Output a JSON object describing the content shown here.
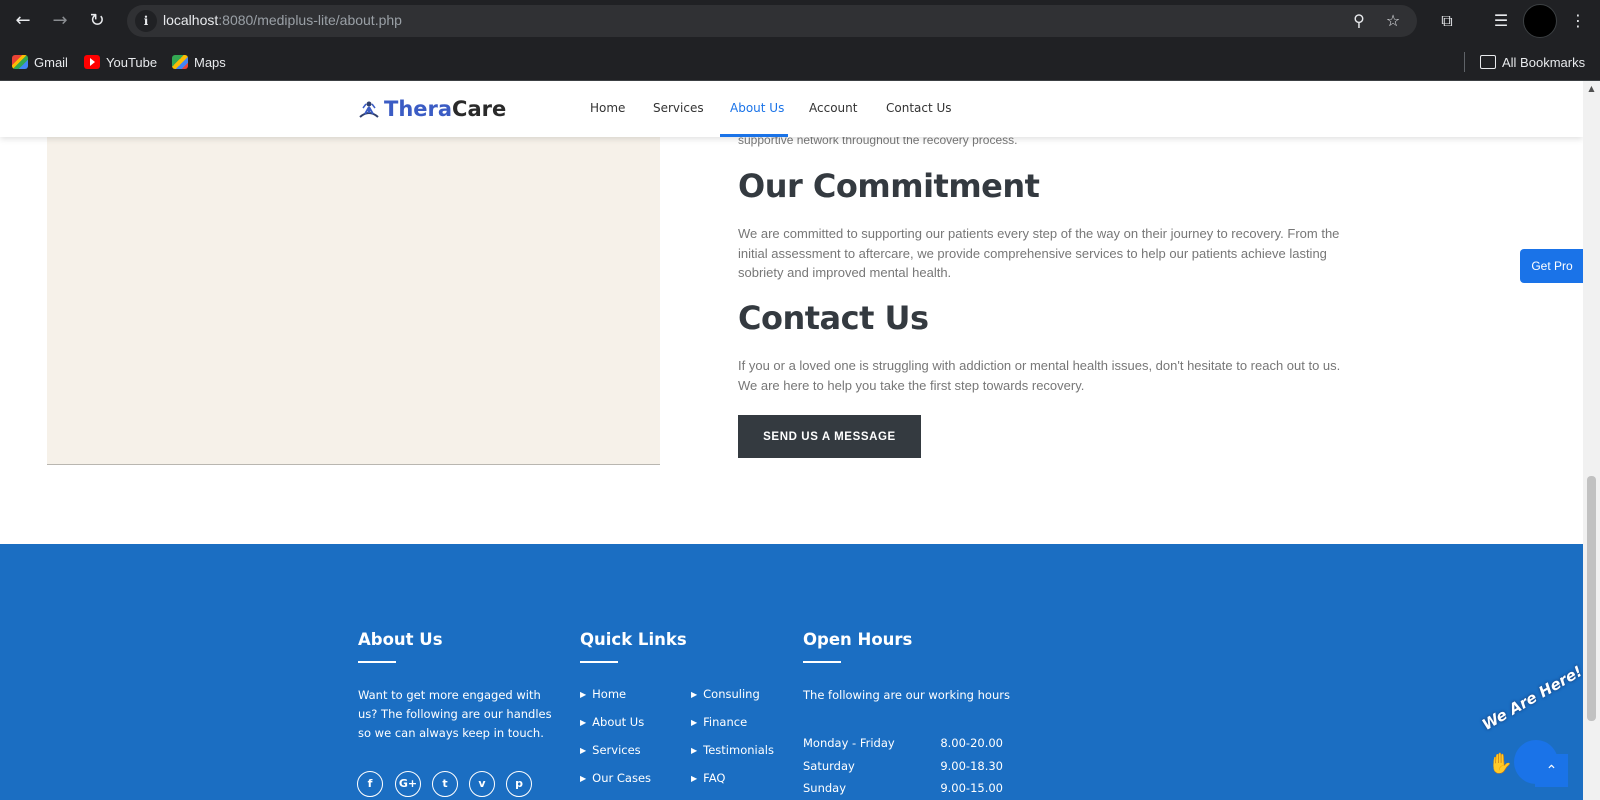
{
  "browser": {
    "url_host": "localhost",
    "url_rest": ":8080/mediplus-lite/about.php",
    "bookmarks": [
      {
        "label": "Gmail",
        "icon": "gmail-icon"
      },
      {
        "label": "YouTube",
        "icon": "youtube-icon"
      },
      {
        "label": "Maps",
        "icon": "maps-icon"
      }
    ],
    "all_bookmarks": "All Bookmarks"
  },
  "header": {
    "logo_part1": "Thera",
    "logo_part2": "Care",
    "menu": [
      "Home",
      "Services",
      "About Us",
      "Account",
      "Contact Us"
    ],
    "active_menu": "About Us"
  },
  "main": {
    "prev_text": "supportive network throughout the recovery process.",
    "commitment_title": "Our Commitment",
    "commitment_text": "We are committed to supporting our patients every step of the way on their journey to recovery. From the initial assessment to aftercare, we provide comprehensive services to help our patients achieve lasting sobriety and improved mental health.",
    "contact_title": "Contact Us",
    "contact_text": "If you or a loved one is struggling with addiction or mental health issues, don't hesitate to reach out to us. We are here to help you take the first step towards recovery.",
    "send_button": "SEND US A MESSAGE"
  },
  "footer": {
    "about_title": "About Us",
    "about_text": "Want to get more engaged with us? The following are our handles so we can always keep in touch.",
    "social": [
      "f",
      "G+",
      "t",
      "v",
      "p"
    ],
    "quick_links_title": "Quick Links",
    "quick_links_col1": [
      "Home",
      "About Us",
      "Services",
      "Our Cases"
    ],
    "quick_links_col2": [
      "Consuling",
      "Finance",
      "Testimonials",
      "FAQ"
    ],
    "open_hours_title": "Open Hours",
    "open_hours_text": "The following are our working hours",
    "hours": [
      {
        "day": "Monday - Friday",
        "time": "8.00-20.00"
      },
      {
        "day": "Saturday",
        "time": "9.00-18.30"
      },
      {
        "day": "Sunday",
        "time": "9.00-15.00"
      }
    ]
  },
  "widgets": {
    "get_pro": "Get Pro",
    "chat_label": "We Are Here!"
  },
  "colors": {
    "brand_blue": "#1b6ec2",
    "accent": "#1a73e8",
    "dark_button": "#343a40",
    "image_panel": "#f6f1e9"
  }
}
